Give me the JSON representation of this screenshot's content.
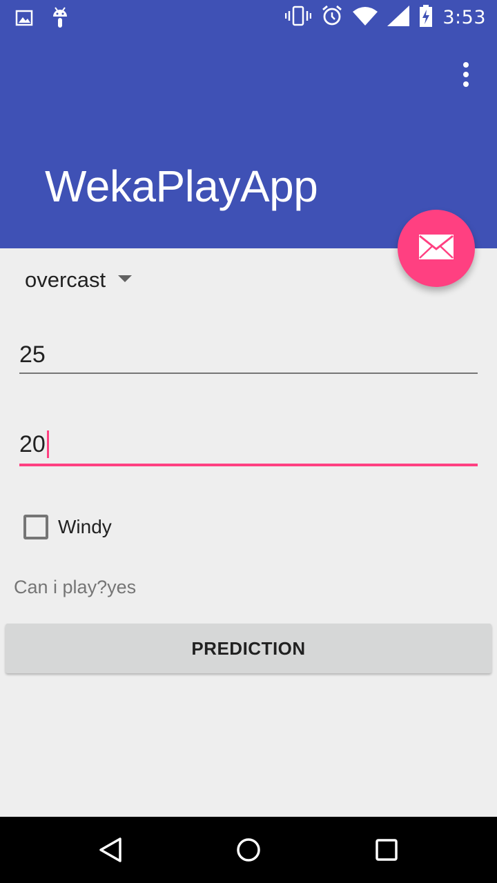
{
  "status_bar": {
    "time": "3:53",
    "left_icons": [
      "image-icon",
      "android-icon"
    ],
    "right_icons": [
      "vibrate-icon",
      "alarm-icon",
      "wifi-icon",
      "signal-icon",
      "battery-charging-icon"
    ]
  },
  "app_bar": {
    "title": "WekaPlayApp",
    "overflow_icon": "more-vert-icon",
    "background_color": "#3f51b5"
  },
  "fab": {
    "icon": "mail-icon",
    "color": "#ff4081"
  },
  "form": {
    "outlook_selected": "overcast",
    "temperature_value": "25",
    "humidity_value": "20",
    "windy_label": "Windy",
    "windy_checked": false
  },
  "result_text": "Can i play?yes",
  "prediction_button_label": "PREDICTION",
  "nav_bar": {
    "icons": [
      "back-icon",
      "home-icon",
      "recents-icon"
    ]
  },
  "colors": {
    "primary": "#3f51b5",
    "accent": "#ff4081",
    "background": "#eeeeee"
  }
}
